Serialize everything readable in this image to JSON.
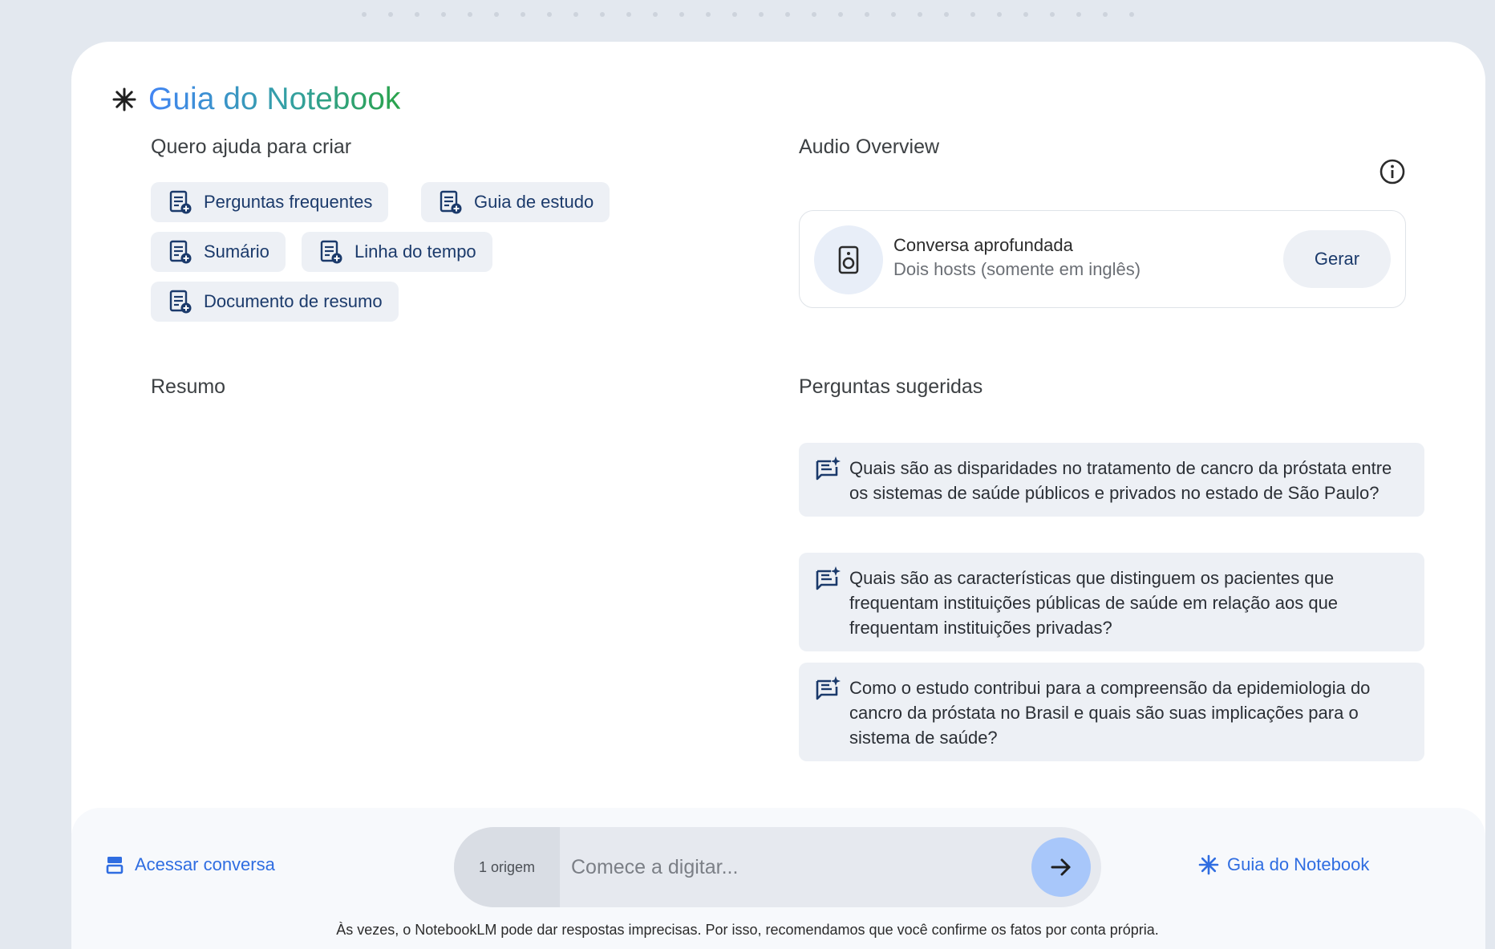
{
  "guide": {
    "title": "Guia do Notebook",
    "icon": "spark-icon"
  },
  "create": {
    "heading": "Quero ajuda para criar",
    "chips": [
      {
        "label": "Perguntas frequentes",
        "icon": "doc-add-icon"
      },
      {
        "label": "Guia de estudo",
        "icon": "doc-add-icon"
      },
      {
        "label": "Sumário",
        "icon": "doc-add-icon"
      },
      {
        "label": "Linha do tempo",
        "icon": "doc-add-icon"
      },
      {
        "label": "Documento de resumo",
        "icon": "doc-add-icon"
      }
    ]
  },
  "audio": {
    "heading": "Audio Overview",
    "info_icon": "info-icon",
    "title": "Conversa aprofundada",
    "subtitle": "Dois hosts (somente em inglês)",
    "button": "Gerar",
    "icon": "speaker-icon"
  },
  "summary": {
    "heading": "Resumo"
  },
  "suggested": {
    "heading": "Perguntas sugeridas",
    "questions": [
      "Quais são as disparidades no tratamento de cancro da próstata entre os sistemas de saúde públicos e privados no estado de São Paulo?",
      "Quais são as características que distinguem os pacientes que frequentam instituições públicas de saúde em relação aos que frequentam instituições privadas?",
      "Como o estudo contribui para a compreensão da epidemiologia do cancro da próstata no Brasil e quais são suas implicações para o sistema de saúde?"
    ]
  },
  "chat": {
    "access_label": "Acessar conversa",
    "source_label": "1 origem",
    "placeholder": "Comece a digitar...",
    "guide_label": "Guia do Notebook",
    "disclaimer": "Às vezes, o NotebookLM pode dar respostas imprecisas. Por isso, recomendamos que você confirme os fatos por conta própria."
  },
  "colors": {
    "accent": "#2f6de1",
    "chip_bg": "#edf0f5",
    "send_bg": "#a8c7fa"
  }
}
